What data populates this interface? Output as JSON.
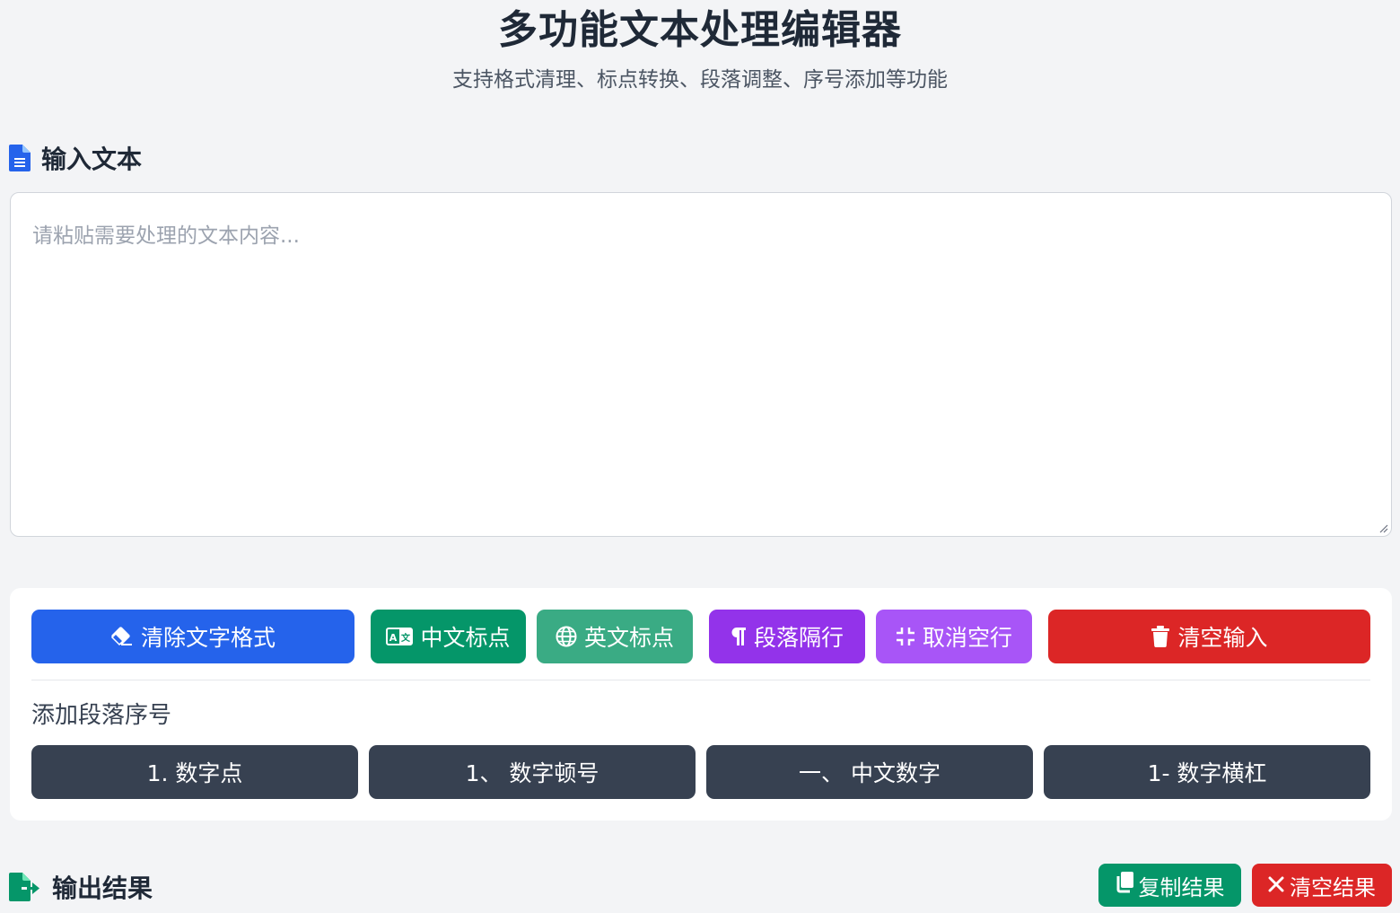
{
  "header": {
    "title": "多功能文本处理编辑器",
    "subtitle": "支持格式清理、标点转换、段落调整、序号添加等功能"
  },
  "input_section": {
    "heading": "输入文本",
    "icon": "file-text-icon",
    "placeholder": "请粘贴需要处理的文本内容...",
    "value": ""
  },
  "toolbar": {
    "buttons": [
      {
        "label": "清除文字格式",
        "icon": "eraser-icon",
        "color": "#2563eb"
      },
      {
        "label": "中文标点",
        "icon": "language-icon",
        "color": "#059669"
      },
      {
        "label": "英文标点",
        "icon": "globe-icon",
        "color": "#3aab84"
      },
      {
        "label": "段落隔行",
        "icon": "paragraph-icon",
        "color": "#9333ea"
      },
      {
        "label": "取消空行",
        "icon": "compress-icon",
        "color": "#a855f7"
      },
      {
        "label": "清空输入",
        "icon": "trash-icon",
        "color": "#dc2626"
      }
    ],
    "numbering_label": "添加段落序号",
    "numbering_buttons": [
      {
        "label": "1. 数字点"
      },
      {
        "label": "1、 数字顿号"
      },
      {
        "label": "一、 中文数字"
      },
      {
        "label": "1- 数字横杠"
      }
    ],
    "numbering_color": "#374151"
  },
  "output_section": {
    "heading": "输出结果",
    "icon": "file-export-icon",
    "copy_label": "复制结果",
    "copy_icon": "copy-icon",
    "copy_color": "#059669",
    "clear_label": "清空结果",
    "clear_icon": "close-icon",
    "clear_color": "#dc2626"
  }
}
